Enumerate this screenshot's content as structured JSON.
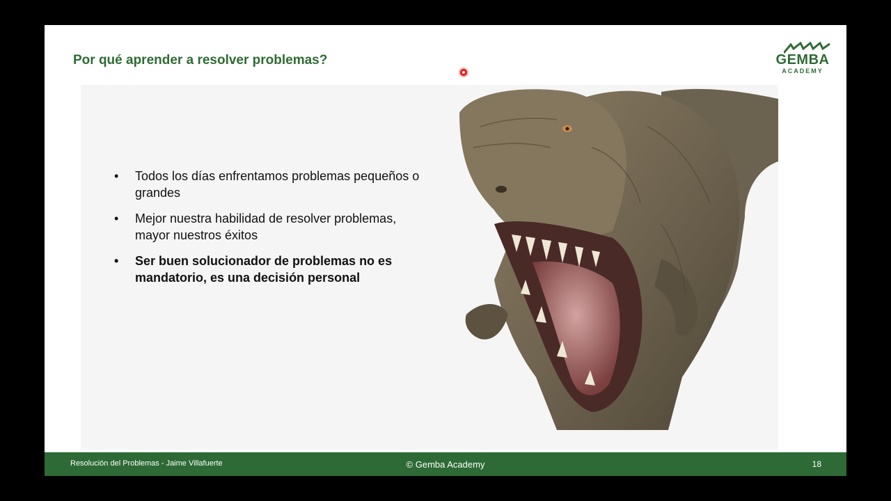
{
  "slide": {
    "title": "Por qué aprender a resolver problemas?",
    "logo": {
      "name": "GEMBA",
      "sub": "ACADEMY",
      "color": "#2f6b34"
    },
    "bullets": [
      {
        "text": "Todos los días enfrentamos problemas pequeños o grandes",
        "bold": false
      },
      {
        "text": "Mejor nuestra habilidad de resolver problemas, mayor nuestros éxitos",
        "bold": false
      },
      {
        "text": "Ser buen solucionador de problemas no es mandatorio, es una decisión personal",
        "bold": true
      }
    ],
    "image": {
      "icon": "t-rex-image"
    }
  },
  "footer": {
    "left": "Resolución del Problemas - Jaime Villafuerte",
    "center": "© Gemba Academy",
    "page": "18",
    "color": "#2d6a35"
  },
  "cursor": {
    "icon": "laser-pointer-icon"
  }
}
